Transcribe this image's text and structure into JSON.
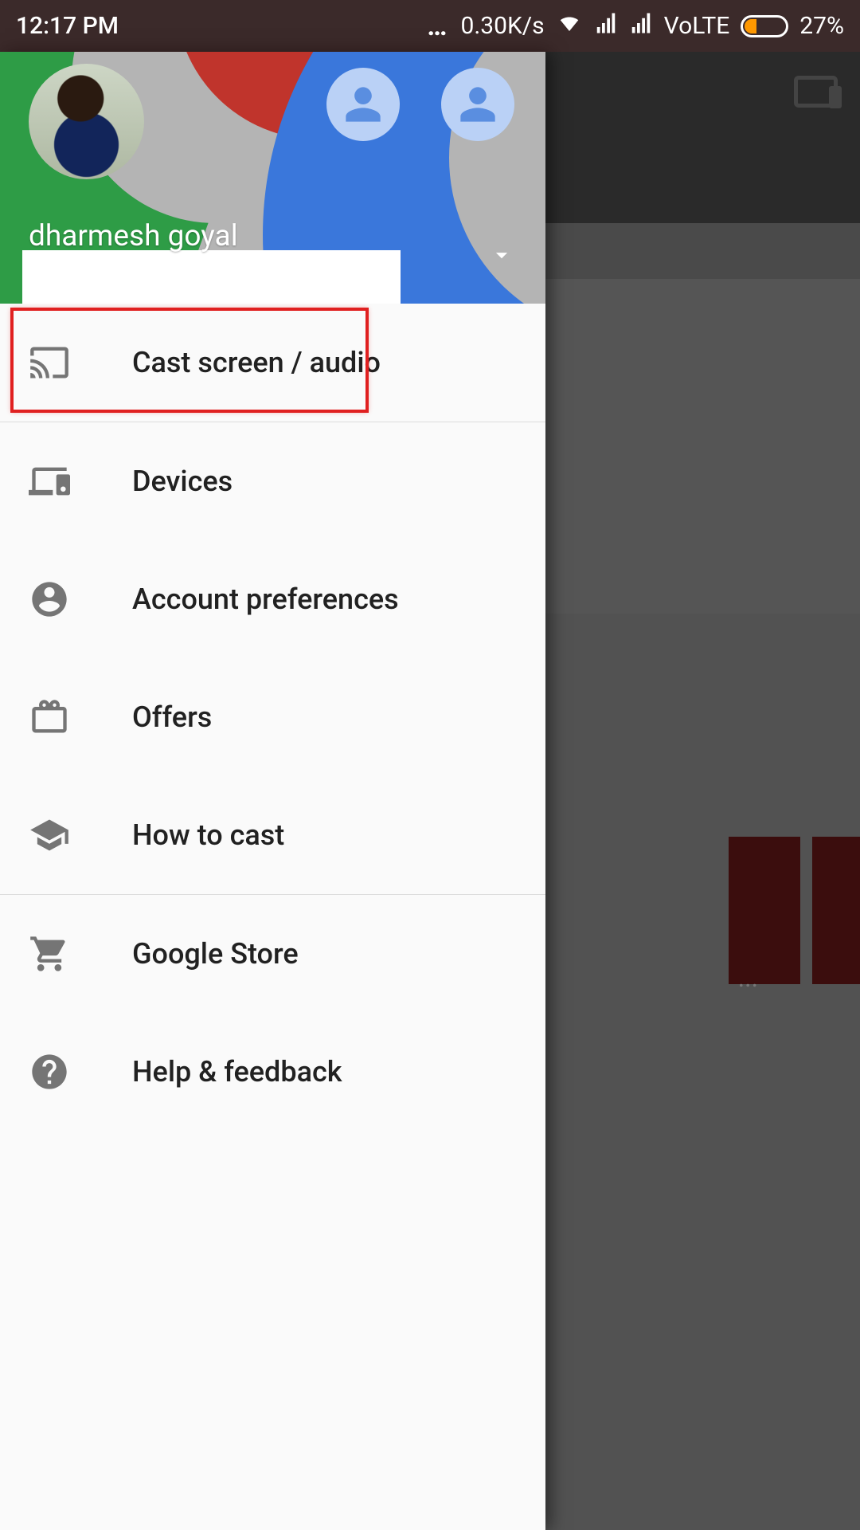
{
  "status_bar": {
    "time": "12:17 PM",
    "dots": "…",
    "speed": "0.30K/s",
    "volte": "VoLTE",
    "battery_pct": "27%"
  },
  "account": {
    "name": "dharmesh goyal"
  },
  "menu": {
    "items": [
      {
        "label": "Cast screen / audio"
      },
      {
        "label": "Devices"
      },
      {
        "label": "Account preferences"
      },
      {
        "label": "Offers"
      },
      {
        "label": "How to cast"
      },
      {
        "label": "Google Store"
      },
      {
        "label": "Help & feedback"
      }
    ]
  },
  "bg_snippet": "..."
}
